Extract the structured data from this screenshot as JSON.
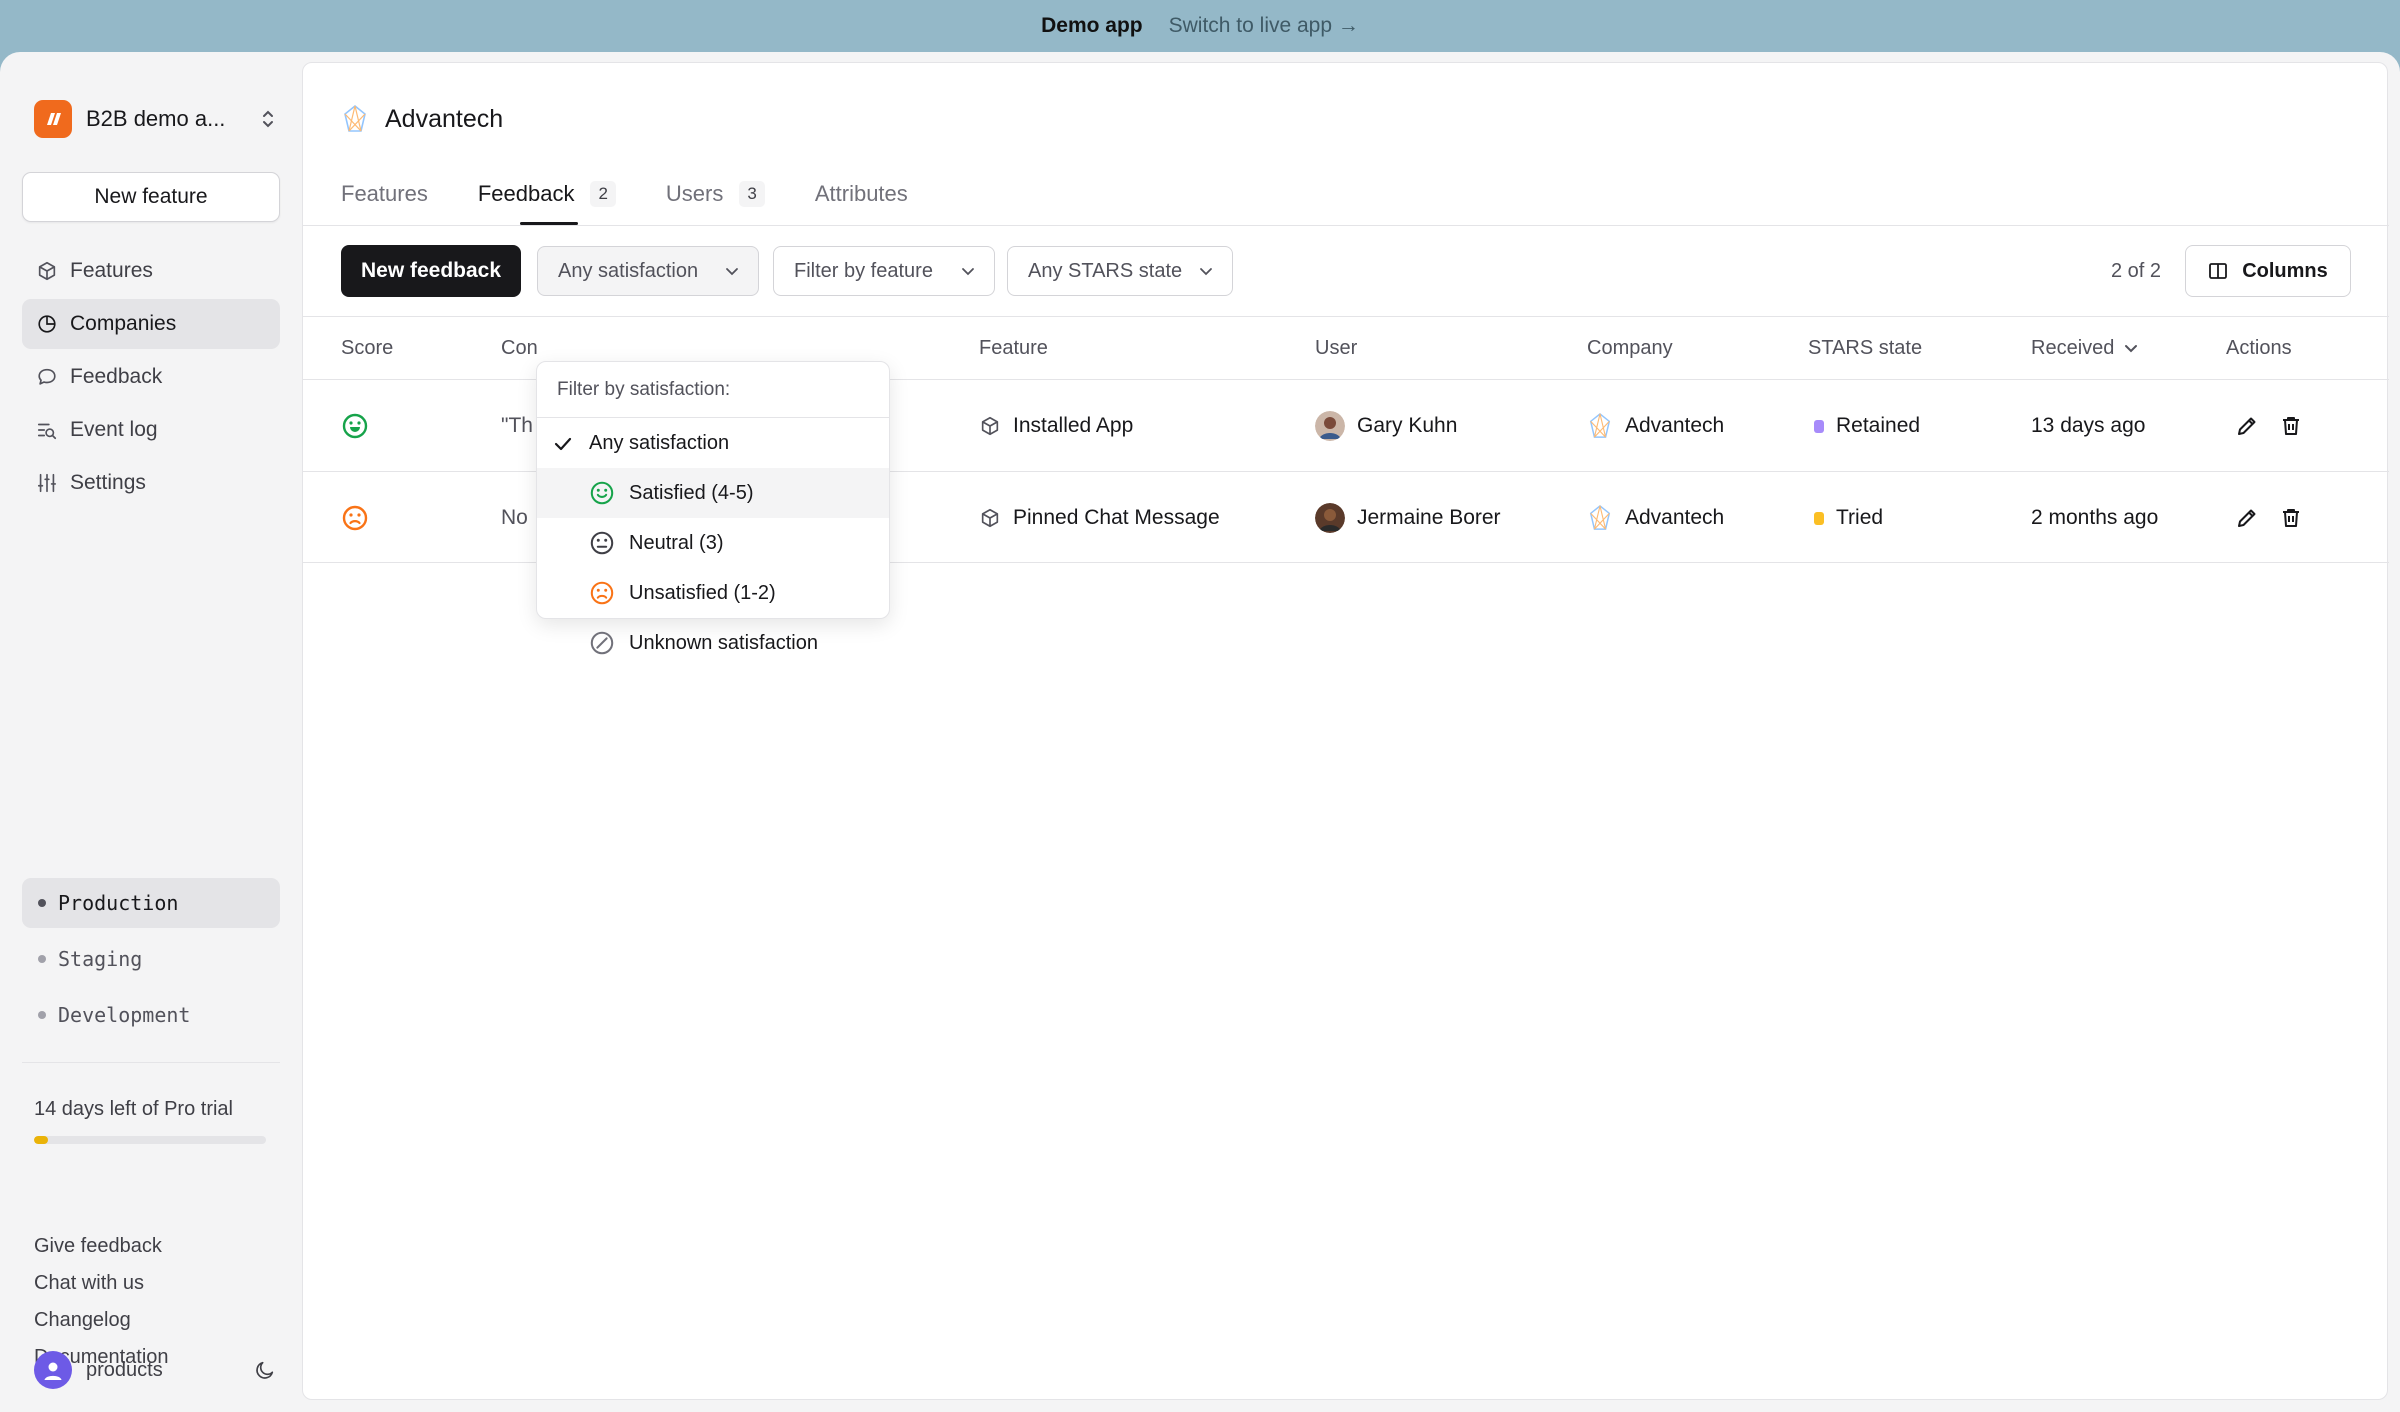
{
  "topbar": {
    "demo": "Demo app",
    "switch": "Switch to live app →"
  },
  "sidebar": {
    "org_name": "B2B demo a...",
    "new_feature": "New feature",
    "nav": [
      {
        "label": "Features",
        "icon": "cube-icon"
      },
      {
        "label": "Companies",
        "icon": "pie-chart-icon"
      },
      {
        "label": "Feedback",
        "icon": "chat-bubble-icon"
      },
      {
        "label": "Event log",
        "icon": "event-log-icon"
      },
      {
        "label": "Settings",
        "icon": "sliders-icon"
      }
    ],
    "active_nav": "Companies",
    "environments": [
      "Production",
      "Staging",
      "Development"
    ],
    "active_environment": "Production",
    "trial_text": "14 days left of Pro trial",
    "trial_progress": 0.06,
    "links": [
      "Give feedback",
      "Chat with us",
      "Changelog",
      "Documentation"
    ],
    "user": "products"
  },
  "main": {
    "company": "Advantech",
    "tabs": [
      {
        "label": "Features",
        "count": ""
      },
      {
        "label": "Feedback",
        "count": "2"
      },
      {
        "label": "Users",
        "count": "3"
      },
      {
        "label": "Attributes",
        "count": ""
      }
    ],
    "active_tab": "Feedback",
    "toolbar": {
      "new_feedback": "New feedback",
      "satisfaction_filter": "Any satisfaction",
      "feature_filter": "Filter by feature",
      "stars_filter": "Any STARS state",
      "count": "2 of 2",
      "columns": "Columns"
    },
    "table": {
      "columns": [
        "Score",
        "Con",
        "Feature",
        "User",
        "Company",
        "STARS state",
        "Received",
        "Actions"
      ],
      "rows": [
        {
          "score": "satisfied",
          "comment": "\"Th",
          "feature": "Installed App",
          "user": "Gary Kuhn",
          "company": "Advantech",
          "state": "Retained",
          "state_color": "#a78bfa",
          "received": "13 days ago"
        },
        {
          "score": "unsatisfied",
          "comment": "No",
          "feature": "Pinned Chat Message",
          "user": "Jermaine Borer",
          "company": "Advantech",
          "state": "Tried",
          "state_color": "#fbbf24",
          "received": "2 months ago"
        }
      ]
    },
    "dropdown": {
      "header": "Filter by satisfaction:",
      "options": [
        {
          "label": "Any satisfaction",
          "icon": "check-icon",
          "selected": true
        },
        {
          "label": "Satisfied (4-5)",
          "icon": "smile-icon"
        },
        {
          "label": "Neutral (3)",
          "icon": "neutral-face-icon"
        },
        {
          "label": "Unsatisfied (1-2)",
          "icon": "frown-icon"
        },
        {
          "label": "Unknown satisfaction",
          "icon": "slash-circle-icon"
        }
      ]
    }
  },
  "colors": {
    "satisfied": "#16a34a",
    "unsatisfied": "#f97316",
    "brand": "#f06a1d",
    "avatar": "#6d5ae6"
  }
}
